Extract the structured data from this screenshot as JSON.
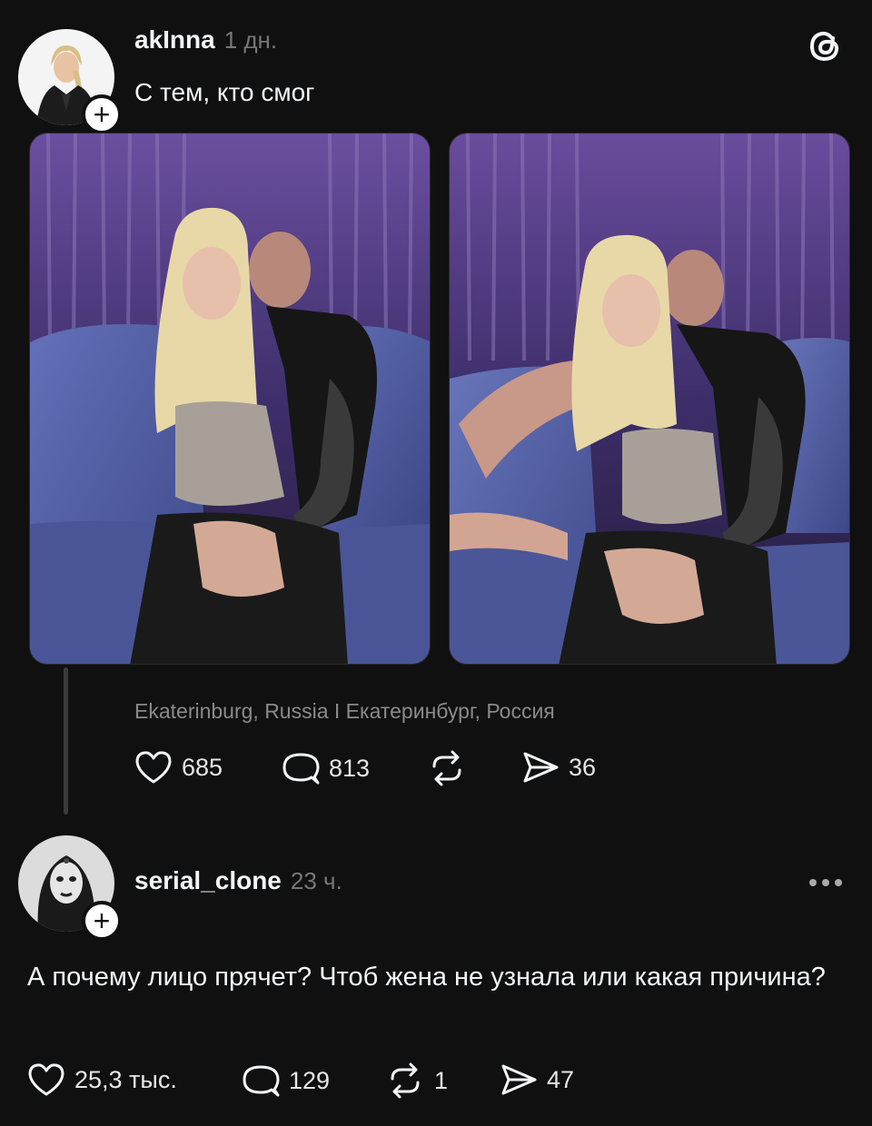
{
  "post": {
    "username": "akInna",
    "time": "1 дн.",
    "text": "С тем, кто смог",
    "location": "Ekaterinburg, Russia I Екатеринбург, Россия",
    "stats": {
      "likes": "685",
      "replies": "813",
      "shares": "36"
    },
    "photos": [
      {
        "description": "photo-1"
      },
      {
        "description": "photo-2"
      }
    ]
  },
  "reply": {
    "username": "serial_clone",
    "time": "23 ч.",
    "text": "А почему лицо прячет? Чтоб жена не узнала или какая причина?",
    "stats": {
      "likes": "25,3 тыс.",
      "replies": "129",
      "reposts": "1",
      "shares": "47"
    }
  },
  "icons": {
    "app": "threads-logo-icon",
    "like": "heart-icon",
    "reply": "comment-icon",
    "repost": "repost-icon",
    "share": "share-icon",
    "more": "more-icon",
    "follow": "plus-icon"
  },
  "colors": {
    "background": "#101010",
    "text": "#f3f5f7",
    "muted": "#777777",
    "thread_line": "#3a3a3a"
  }
}
